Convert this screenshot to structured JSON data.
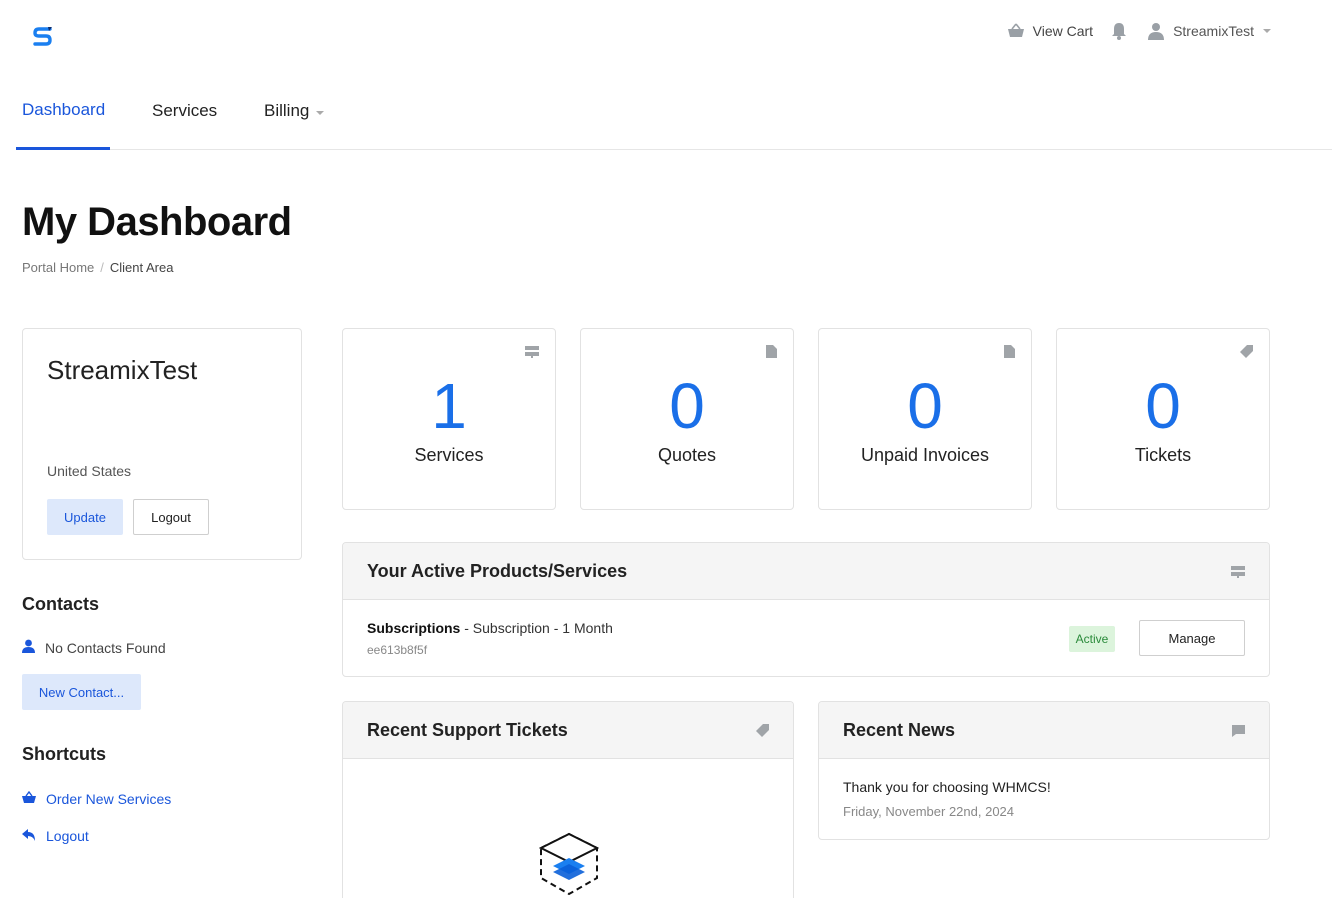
{
  "header": {
    "view_cart": "View Cart",
    "username": "StreamixTest"
  },
  "nav": {
    "dashboard": "Dashboard",
    "services": "Services",
    "billing": "Billing"
  },
  "page": {
    "title": "My Dashboard",
    "breadcrumb": [
      "Portal Home",
      "Client Area"
    ]
  },
  "profile": {
    "name": "StreamixTest",
    "country": "United States",
    "update_label": "Update",
    "logout_label": "Logout"
  },
  "contacts": {
    "heading": "Contacts",
    "empty_text": "No Contacts Found",
    "new_label": "New Contact..."
  },
  "shortcuts": {
    "heading": "Shortcuts",
    "items": [
      {
        "label": "Order New Services",
        "icon": "basket-icon"
      },
      {
        "label": "Logout",
        "icon": "reply-arrow-icon"
      }
    ]
  },
  "stats": [
    {
      "value": "1",
      "label": "Services",
      "icon": "server-icon"
    },
    {
      "value": "0",
      "label": "Quotes",
      "icon": "file-icon"
    },
    {
      "value": "0",
      "label": "Unpaid Invoices",
      "icon": "file-icon"
    },
    {
      "value": "0",
      "label": "Tickets",
      "icon": "tag-icon"
    }
  ],
  "products": {
    "title": "Your Active Products/Services",
    "item": {
      "group": "Subscriptions",
      "rest": " - Subscription - 1 Month",
      "id": "ee613b8f5f",
      "status": "Active",
      "manage_label": "Manage"
    }
  },
  "tickets": {
    "title": "Recent Support Tickets"
  },
  "news": {
    "title": "Recent News",
    "item_text": "Thank you for choosing WHMCS!",
    "item_date": "Friday, November 22nd, 2024"
  },
  "colors": {
    "accent": "#1a56db",
    "stat_number": "#1a6fe8",
    "active_badge_bg": "#dcf4dc",
    "active_badge_text": "#2a8a3a"
  }
}
